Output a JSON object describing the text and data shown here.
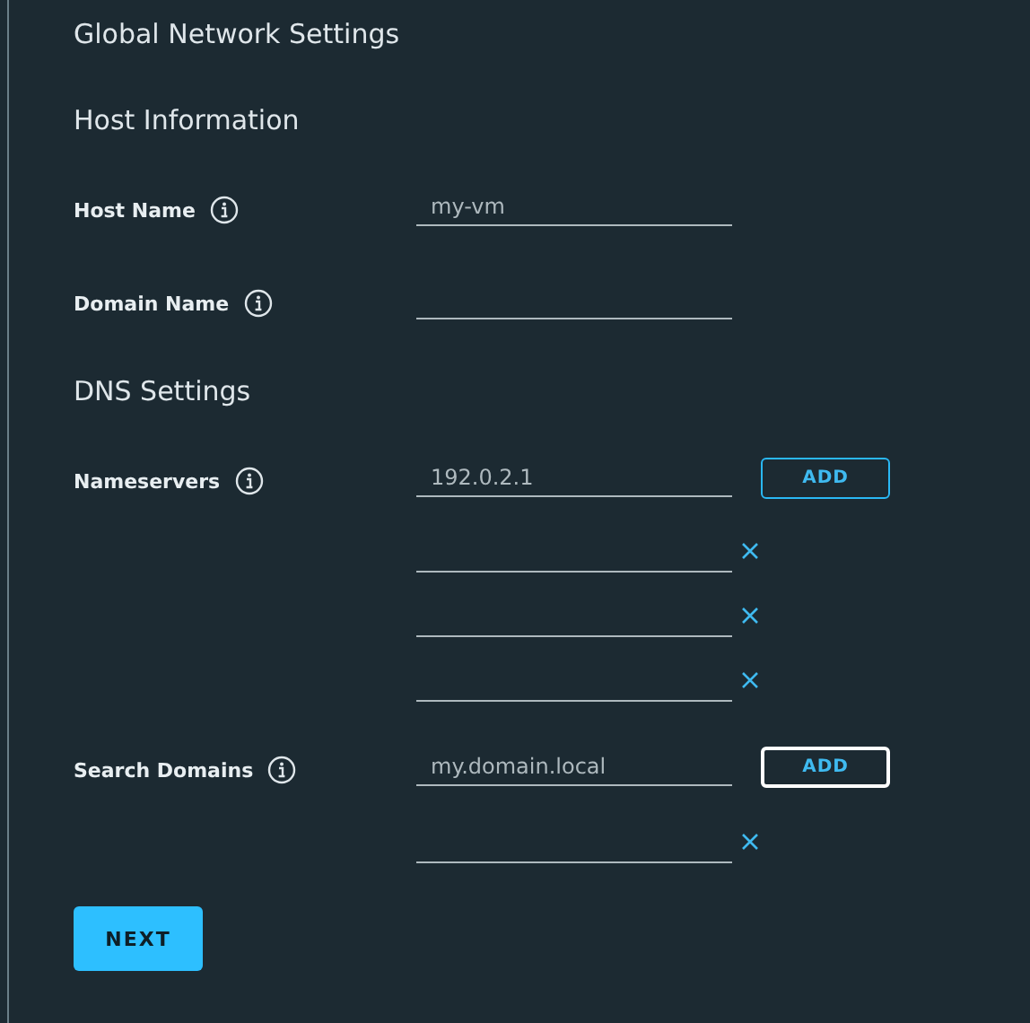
{
  "title": "Global Network Settings",
  "sections": [
    {
      "heading": "Host Information",
      "fields": [
        {
          "label": "Host Name",
          "value": "my-vm",
          "info": true
        },
        {
          "label": "Domain Name",
          "info": true
        }
      ]
    },
    {
      "heading": "DNS Settings",
      "fields": [
        {
          "label": "Nameservers",
          "value": "192.0.2.1",
          "info": true,
          "add_button": {
            "label": "ADD",
            "focused": false
          },
          "extra_entries": [
            {
              "removable": true
            },
            {
              "removable": true
            },
            {
              "removable": true
            }
          ]
        },
        {
          "label": "Search Domains",
          "value": "my.domain.local",
          "info": true,
          "add_button": {
            "label": "ADD",
            "focused": true
          },
          "extra_entries": [
            {
              "removable": true
            }
          ]
        }
      ]
    }
  ],
  "next_button": {
    "label": "NEXT"
  }
}
